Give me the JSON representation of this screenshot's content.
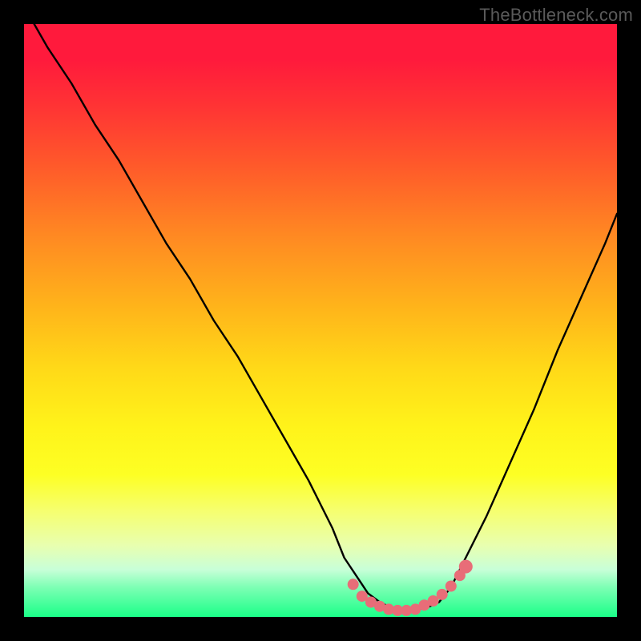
{
  "watermark": "TheBottleneck.com",
  "colors": {
    "line": "#000000",
    "marker": "#e86d78",
    "frame": "#000000"
  },
  "chart_data": {
    "type": "line",
    "title": "",
    "xlabel": "",
    "ylabel": "",
    "xlim": [
      0,
      100
    ],
    "ylim": [
      0,
      100
    ],
    "grid": false,
    "legend": false,
    "series": [
      {
        "name": "bottleneck-curve",
        "x": [
          0,
          4,
          8,
          12,
          16,
          20,
          24,
          28,
          32,
          36,
          40,
          44,
          48,
          52,
          54,
          56,
          58,
          60,
          62,
          64,
          66,
          68,
          70,
          72,
          74,
          78,
          82,
          86,
          90,
          94,
          98,
          100
        ],
        "y": [
          103,
          96,
          90,
          83,
          77,
          70,
          63,
          57,
          50,
          44,
          37,
          30,
          23,
          15,
          10,
          7,
          4,
          2.5,
          1.5,
          1.2,
          1.2,
          1.6,
          2.5,
          5,
          9,
          17,
          26,
          35,
          45,
          54,
          63,
          68
        ]
      }
    ],
    "markers": {
      "name": "highlight-dots",
      "x": [
        55.5,
        57,
        58.5,
        60,
        61.5,
        63,
        64.5,
        66,
        67.5,
        69,
        70.5,
        72,
        73.5,
        74.5
      ],
      "y": [
        5.5,
        3.5,
        2.5,
        1.8,
        1.3,
        1.1,
        1.1,
        1.3,
        2.0,
        2.7,
        3.8,
        5.2,
        7.0,
        8.5
      ]
    }
  }
}
